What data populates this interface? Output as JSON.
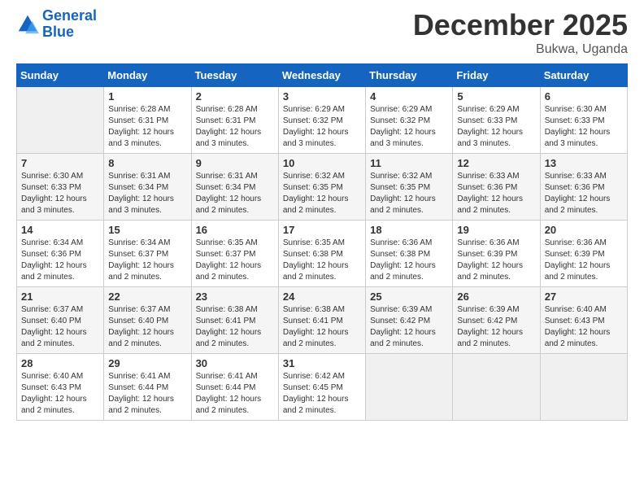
{
  "header": {
    "logo_line1": "General",
    "logo_line2": "Blue",
    "month": "December 2025",
    "location": "Bukwa, Uganda"
  },
  "weekdays": [
    "Sunday",
    "Monday",
    "Tuesday",
    "Wednesday",
    "Thursday",
    "Friday",
    "Saturday"
  ],
  "weeks": [
    [
      {
        "day": "",
        "info": ""
      },
      {
        "day": "1",
        "info": "Sunrise: 6:28 AM\nSunset: 6:31 PM\nDaylight: 12 hours\nand 3 minutes."
      },
      {
        "day": "2",
        "info": "Sunrise: 6:28 AM\nSunset: 6:31 PM\nDaylight: 12 hours\nand 3 minutes."
      },
      {
        "day": "3",
        "info": "Sunrise: 6:29 AM\nSunset: 6:32 PM\nDaylight: 12 hours\nand 3 minutes."
      },
      {
        "day": "4",
        "info": "Sunrise: 6:29 AM\nSunset: 6:32 PM\nDaylight: 12 hours\nand 3 minutes."
      },
      {
        "day": "5",
        "info": "Sunrise: 6:29 AM\nSunset: 6:33 PM\nDaylight: 12 hours\nand 3 minutes."
      },
      {
        "day": "6",
        "info": "Sunrise: 6:30 AM\nSunset: 6:33 PM\nDaylight: 12 hours\nand 3 minutes."
      }
    ],
    [
      {
        "day": "7",
        "info": "Sunrise: 6:30 AM\nSunset: 6:33 PM\nDaylight: 12 hours\nand 3 minutes."
      },
      {
        "day": "8",
        "info": "Sunrise: 6:31 AM\nSunset: 6:34 PM\nDaylight: 12 hours\nand 3 minutes."
      },
      {
        "day": "9",
        "info": "Sunrise: 6:31 AM\nSunset: 6:34 PM\nDaylight: 12 hours\nand 2 minutes."
      },
      {
        "day": "10",
        "info": "Sunrise: 6:32 AM\nSunset: 6:35 PM\nDaylight: 12 hours\nand 2 minutes."
      },
      {
        "day": "11",
        "info": "Sunrise: 6:32 AM\nSunset: 6:35 PM\nDaylight: 12 hours\nand 2 minutes."
      },
      {
        "day": "12",
        "info": "Sunrise: 6:33 AM\nSunset: 6:36 PM\nDaylight: 12 hours\nand 2 minutes."
      },
      {
        "day": "13",
        "info": "Sunrise: 6:33 AM\nSunset: 6:36 PM\nDaylight: 12 hours\nand 2 minutes."
      }
    ],
    [
      {
        "day": "14",
        "info": "Sunrise: 6:34 AM\nSunset: 6:36 PM\nDaylight: 12 hours\nand 2 minutes."
      },
      {
        "day": "15",
        "info": "Sunrise: 6:34 AM\nSunset: 6:37 PM\nDaylight: 12 hours\nand 2 minutes."
      },
      {
        "day": "16",
        "info": "Sunrise: 6:35 AM\nSunset: 6:37 PM\nDaylight: 12 hours\nand 2 minutes."
      },
      {
        "day": "17",
        "info": "Sunrise: 6:35 AM\nSunset: 6:38 PM\nDaylight: 12 hours\nand 2 minutes."
      },
      {
        "day": "18",
        "info": "Sunrise: 6:36 AM\nSunset: 6:38 PM\nDaylight: 12 hours\nand 2 minutes."
      },
      {
        "day": "19",
        "info": "Sunrise: 6:36 AM\nSunset: 6:39 PM\nDaylight: 12 hours\nand 2 minutes."
      },
      {
        "day": "20",
        "info": "Sunrise: 6:36 AM\nSunset: 6:39 PM\nDaylight: 12 hours\nand 2 minutes."
      }
    ],
    [
      {
        "day": "21",
        "info": "Sunrise: 6:37 AM\nSunset: 6:40 PM\nDaylight: 12 hours\nand 2 minutes."
      },
      {
        "day": "22",
        "info": "Sunrise: 6:37 AM\nSunset: 6:40 PM\nDaylight: 12 hours\nand 2 minutes."
      },
      {
        "day": "23",
        "info": "Sunrise: 6:38 AM\nSunset: 6:41 PM\nDaylight: 12 hours\nand 2 minutes."
      },
      {
        "day": "24",
        "info": "Sunrise: 6:38 AM\nSunset: 6:41 PM\nDaylight: 12 hours\nand 2 minutes."
      },
      {
        "day": "25",
        "info": "Sunrise: 6:39 AM\nSunset: 6:42 PM\nDaylight: 12 hours\nand 2 minutes."
      },
      {
        "day": "26",
        "info": "Sunrise: 6:39 AM\nSunset: 6:42 PM\nDaylight: 12 hours\nand 2 minutes."
      },
      {
        "day": "27",
        "info": "Sunrise: 6:40 AM\nSunset: 6:43 PM\nDaylight: 12 hours\nand 2 minutes."
      }
    ],
    [
      {
        "day": "28",
        "info": "Sunrise: 6:40 AM\nSunset: 6:43 PM\nDaylight: 12 hours\nand 2 minutes."
      },
      {
        "day": "29",
        "info": "Sunrise: 6:41 AM\nSunset: 6:44 PM\nDaylight: 12 hours\nand 2 minutes."
      },
      {
        "day": "30",
        "info": "Sunrise: 6:41 AM\nSunset: 6:44 PM\nDaylight: 12 hours\nand 2 minutes."
      },
      {
        "day": "31",
        "info": "Sunrise: 6:42 AM\nSunset: 6:45 PM\nDaylight: 12 hours\nand 2 minutes."
      },
      {
        "day": "",
        "info": ""
      },
      {
        "day": "",
        "info": ""
      },
      {
        "day": "",
        "info": ""
      }
    ]
  ]
}
